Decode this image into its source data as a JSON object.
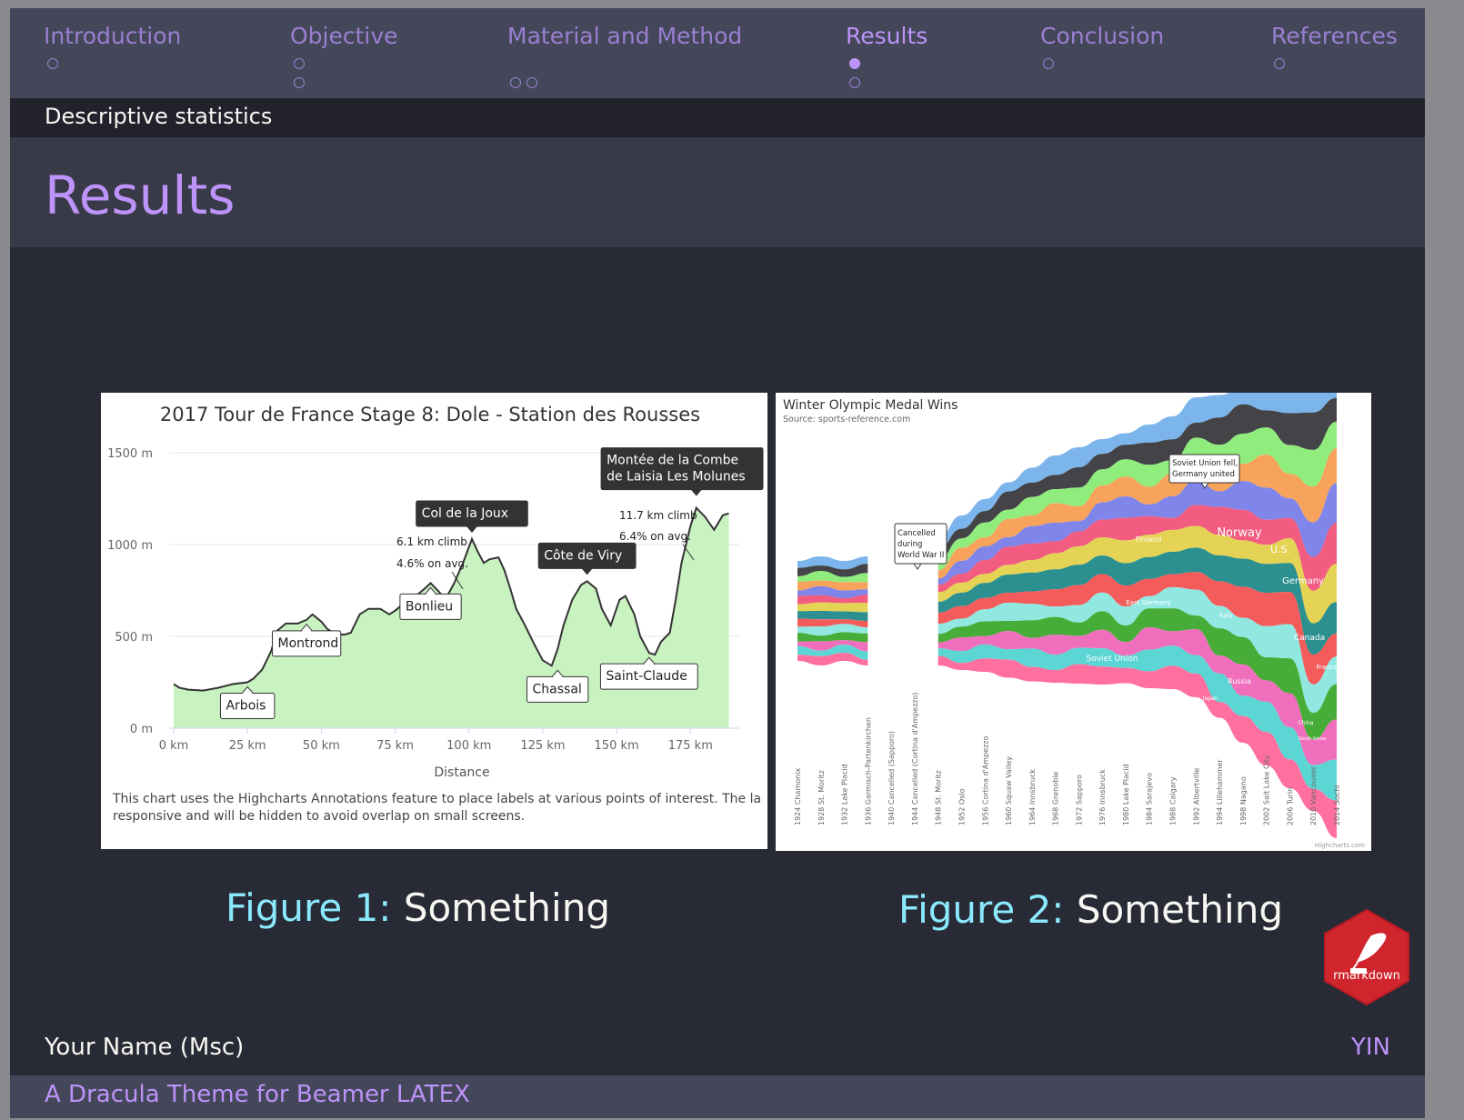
{
  "nav": {
    "sections": [
      {
        "label": "Introduction"
      },
      {
        "label": "Objective"
      },
      {
        "label": "Material and Method"
      },
      {
        "label": "Results"
      },
      {
        "label": "Conclusion"
      },
      {
        "label": "References"
      }
    ],
    "active": "Results"
  },
  "subsection": "Descriptive statistics",
  "frame_title": "Results",
  "figures": [
    {
      "label": "Figure 1:",
      "text": "Something"
    },
    {
      "label": "Figure 2:",
      "text": "Something"
    }
  ],
  "footer": {
    "author": "Your Name (Msc)",
    "institute": "YIN",
    "theme": "A Dracula Theme for Beamer LATEX"
  },
  "logo_text": "rmarkdown",
  "colors": {
    "background": "#282a36",
    "accent_purple": "#bd93f9",
    "caption_cyan": "#8be9fd",
    "foreground": "#f8f8f2",
    "logo_red": "#d0252d"
  },
  "chart_data": [
    {
      "type": "area",
      "title": "2017 Tour de France Stage 8: Dole - Station des Rousses",
      "xlabel": "Distance",
      "ylabel": "",
      "x_ticks": [
        "0 km",
        "25 km",
        "50 km",
        "75 km",
        "100 km",
        "125 km",
        "150 km",
        "175 km"
      ],
      "y_ticks": [
        "0 m",
        "500 m",
        "1000 m",
        "1500 m"
      ],
      "xlim": [
        0,
        190
      ],
      "ylim": [
        0,
        1500
      ],
      "grid": true,
      "x": [
        0,
        2,
        5,
        10,
        15,
        20,
        25,
        27,
        30,
        33,
        35,
        38,
        42,
        45,
        47,
        50,
        52,
        55,
        58,
        60,
        63,
        66,
        70,
        73,
        75,
        78,
        80,
        82,
        85,
        87,
        90,
        92,
        95,
        98,
        101,
        103,
        105,
        107,
        110,
        112,
        114,
        116,
        119,
        122,
        125,
        128,
        130,
        132,
        135,
        138,
        140,
        143,
        145,
        148,
        151,
        153,
        156,
        158,
        161,
        163,
        165,
        168,
        170,
        172,
        175,
        177,
        180,
        183,
        186,
        188
      ],
      "y": [
        240,
        220,
        210,
        205,
        220,
        240,
        250,
        270,
        320,
        420,
        530,
        570,
        570,
        590,
        620,
        580,
        540,
        510,
        510,
        520,
        620,
        650,
        650,
        620,
        640,
        680,
        700,
        720,
        760,
        790,
        740,
        700,
        790,
        900,
        1030,
        960,
        900,
        920,
        930,
        860,
        760,
        650,
        560,
        460,
        370,
        340,
        430,
        560,
        700,
        780,
        800,
        760,
        650,
        560,
        700,
        720,
        620,
        500,
        410,
        400,
        470,
        520,
        700,
        900,
        1100,
        1200,
        1150,
        1080,
        1160,
        1170
      ],
      "annotations": [
        {
          "text": "Arbois",
          "x": 25,
          "y": 250
        },
        {
          "text": "Montrond",
          "x": 45,
          "y": 590
        },
        {
          "text": "Bonlieu",
          "x": 87,
          "y": 790
        },
        {
          "text": "Chassal",
          "x": 130,
          "y": 340
        },
        {
          "text": "Saint-Claude",
          "x": 161,
          "y": 410
        },
        {
          "text": "Col de la Joux",
          "x": 101,
          "y": 1030
        },
        {
          "text": "Côte de Viry",
          "x": 140,
          "y": 800
        },
        {
          "text": "Montée de la Combe de Laisia Les Molunes",
          "x": 177,
          "y": 1200
        }
      ],
      "climb_notes": [
        {
          "line1": "6.1 km climb",
          "line2": "4.6% on avg."
        },
        {
          "line1": "11.7 km climb",
          "line2": "6.4% on avg."
        }
      ],
      "caption_text": "This chart uses the Highcharts Annotations feature to place labels at various points of interest. The la responsive and will be hidden to avoid overlap on small screens."
    },
    {
      "type": "area",
      "title": "Winter Olympic Medal Wins",
      "subtitle": "Source: sports-reference.com",
      "categories": [
        "1924 Chamonix",
        "1928 St. Moritz",
        "1932 Lake Placid",
        "1936 Garmisch-Partenkirchen",
        "1940 Cancelled (Sapporo)",
        "1944 Cancelled (Cortina d'Ampezzo)",
        "1948 St. Moritz",
        "1952 Oslo",
        "1956 Cortina d'Ampezzo",
        "1960 Squaw Valley",
        "1964 Innsbruck",
        "1968 Grenoble",
        "1972 Sapporo",
        "1976 Innsbruck",
        "1980 Lake Placid",
        "1984 Sarajevo",
        "1988 Calgary",
        "1992 Albertville",
        "1994 Lillehammer",
        "1998 Nagano",
        "2002 Salt Lake City",
        "2006 Turin",
        "2010 Vancouver",
        "2014 Sochi"
      ],
      "series_labels": [
        "Finland",
        "Norway",
        "U.S.",
        "Germany",
        "East Germany",
        "Italy",
        "Canada",
        "France",
        "Soviet Union",
        "Russia",
        "Japan",
        "China",
        "South Korea"
      ],
      "annotations": [
        {
          "text": "Cancelled during World War II"
        },
        {
          "text": "Soviet Union fell, Germany united"
        }
      ],
      "credits": "Highcharts.com"
    }
  ]
}
